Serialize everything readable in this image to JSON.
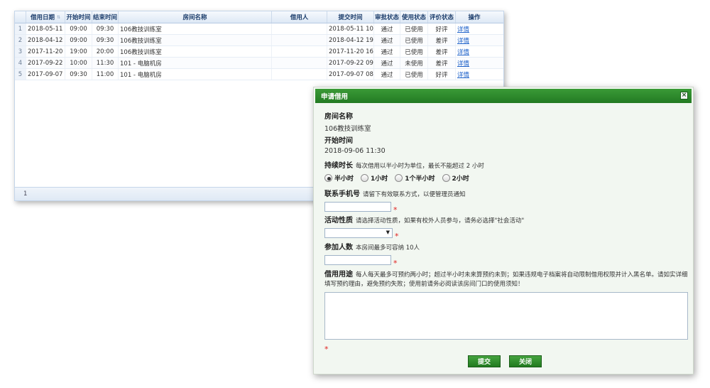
{
  "grid": {
    "columns": [
      "借用日期",
      "开始时间",
      "结束时间",
      "房间名称",
      "借用人",
      "提交时间",
      "审批状态",
      "使用状态",
      "评价状态",
      "操作"
    ],
    "rows": [
      {
        "n": "1",
        "date": "2018-05-11",
        "start": "09:00",
        "end": "09:30",
        "room": "106教技训练室",
        "user": "",
        "submit": "2018-05-11 10:",
        "approval": "通过",
        "usage": "已使用",
        "eval": "好评",
        "op": "详情"
      },
      {
        "n": "2",
        "date": "2018-04-12",
        "start": "09:00",
        "end": "09:30",
        "room": "106教技训练室",
        "user": "",
        "submit": "2018-04-12 19:",
        "approval": "通过",
        "usage": "已使用",
        "eval": "差评",
        "op": "详情"
      },
      {
        "n": "3",
        "date": "2017-11-20",
        "start": "19:00",
        "end": "20:00",
        "room": "106教技训练室",
        "user": "",
        "submit": "2017-11-20 16:",
        "approval": "通过",
        "usage": "已使用",
        "eval": "差评",
        "op": "详情"
      },
      {
        "n": "4",
        "date": "2017-09-22",
        "start": "10:00",
        "end": "11:30",
        "room": "101 - 电脑机房",
        "user": "",
        "submit": "2017-09-22 09:",
        "approval": "通过",
        "usage": "未使用",
        "eval": "差评",
        "op": "详情"
      },
      {
        "n": "5",
        "date": "2017-09-07",
        "start": "09:30",
        "end": "11:00",
        "room": "101 - 电脑机房",
        "user": "",
        "submit": "2017-09-07 08:",
        "approval": "通过",
        "usage": "已使用",
        "eval": "好评",
        "op": "详情"
      }
    ],
    "footer_page": "1"
  },
  "dialog": {
    "title": "申请借用",
    "close_label": "×",
    "room_label": "房间名称",
    "room_value": "106教技训练室",
    "start_label": "开始时间",
    "start_value": "2018-09-06 11:30",
    "duration_label": "持续时长",
    "duration_hint": "每次借用以半小时为单位，最长不能超过 2 小时",
    "duration_options": [
      "半小时",
      "1小时",
      "1个半小时",
      "2小时"
    ],
    "phone_label": "联系手机号",
    "phone_hint": "请留下有效联系方式，以便管理员通知",
    "activity_label": "活动性质",
    "activity_hint": "请选择活动性质，如果有校外人员参与，请务必选择\"社会活动\"",
    "people_label": "参加人数",
    "people_hint": "本房间最多可容纳 10人",
    "purpose_label": "借用用途",
    "purpose_hint": "每人每天最多可预约两小时；超过半小时未来算预约未到；如果违规电子档案将自动限制借用权限并计入黑名单。请如实详细填写预约理由，避免预约失败；使用前请务必阅读该房间门口的使用须知！",
    "required_mark": "*",
    "submit_label": "提交",
    "close_button_label": "关闭"
  },
  "colors": {
    "title_bar": "#237a22",
    "button": "#2f8f2b",
    "grid_header": "#dde8f5",
    "link": "#1a5fc8",
    "required": "#e02020"
  }
}
